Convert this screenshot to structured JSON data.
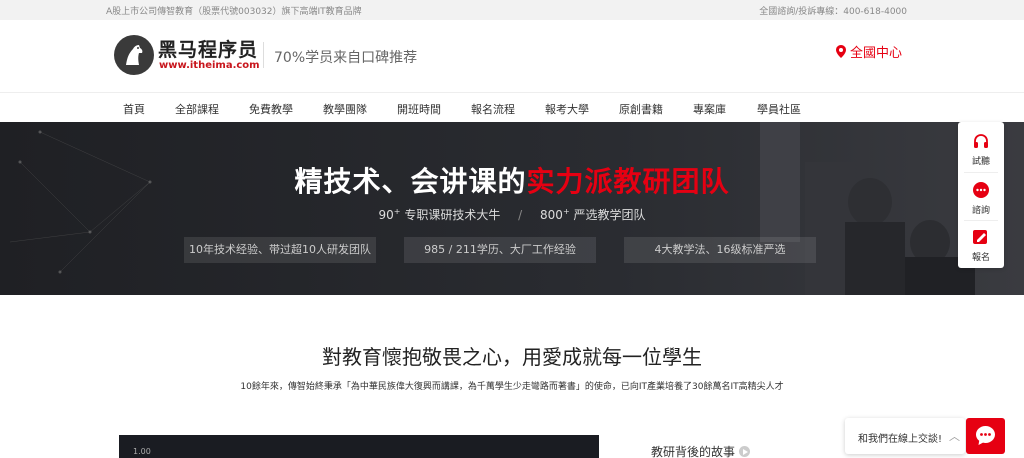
{
  "topbar": {
    "left_text": "A股上市公司傳智教育（股票代號003032）旗下高端IT教育品牌",
    "right_text": "全國諮詢/投訴專線：400-618-4000"
  },
  "header": {
    "logo_name": "黑马程序员",
    "logo_url": "www.itheima.com",
    "slogan": "70%学员来自口碑推荐",
    "location": "全國中心"
  },
  "nav": {
    "items": [
      "首頁",
      "全部課程",
      "免費教學",
      "教學團隊",
      "開班時間",
      "報名流程",
      "報考大學",
      "原創書籍",
      "專案庫",
      "學員社區"
    ]
  },
  "banner": {
    "title_white": "精技术、会讲课的",
    "title_red": "实力派教研团队",
    "stat1_num": "90",
    "stat1_sup": "+",
    "stat1_text": "专职课研技术大牛",
    "stat_sep": "/",
    "stat2_num": "800",
    "stat2_sup": "+",
    "stat2_text": "严选教学团队",
    "pills": [
      "10年技术经验、带过超10人研发团队",
      "985 / 211学历、大厂工作经验",
      "4大教学法、16级标准严选"
    ]
  },
  "side": {
    "items": [
      {
        "label": "試聽",
        "icon": "headphones-icon"
      },
      {
        "label": "諮詢",
        "icon": "chat-icon"
      },
      {
        "label": "報名",
        "icon": "edit-icon"
      }
    ]
  },
  "section": {
    "title": "對教育懷抱敬畏之心，用愛成就每一位學生",
    "desc": "10餘年來，傳智始終秉承「為中華民族偉大復興而講課，為千萬學生少走彎路而著書」的使命，已向IT產業培養了30餘萬名IT高精尖人才"
  },
  "video": {
    "time": "1.00"
  },
  "story": {
    "label": "教研背後的故事"
  },
  "chat": {
    "text": "和我們在線上交談!",
    "chevron": "︿"
  },
  "colors": {
    "accent": "#e60012",
    "banner_bg": "#232428"
  }
}
